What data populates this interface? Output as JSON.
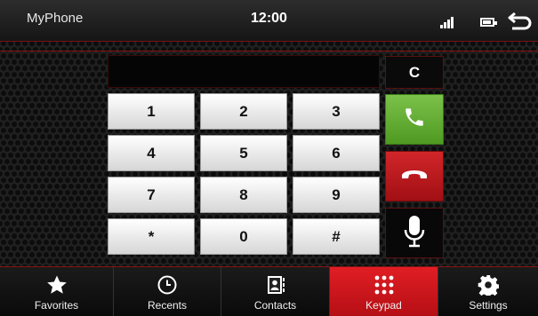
{
  "status": {
    "device_name": "MyPhone",
    "time": "12:00",
    "icons": [
      "signal-icon",
      "battery-icon",
      "back-arrow-icon"
    ]
  },
  "dialer": {
    "display_value": "",
    "clear_label": "C",
    "keys": [
      "1",
      "2",
      "3",
      "4",
      "5",
      "6",
      "7",
      "8",
      "9",
      "*",
      "0",
      "#"
    ],
    "actions": [
      "phone-call-icon",
      "phone-hangup-icon",
      "microphone-icon"
    ]
  },
  "nav": {
    "items": [
      {
        "label": "Favorites",
        "icon": "star-icon"
      },
      {
        "label": "Recents",
        "icon": "clock-icon"
      },
      {
        "label": "Contacts",
        "icon": "contacts-book-icon"
      },
      {
        "label": "Keypad",
        "icon": "keypad-grid-icon",
        "active": true
      },
      {
        "label": "Settings",
        "icon": "gear-icon"
      }
    ]
  },
  "colors": {
    "accent_red": "#c4161c",
    "call_green": "#5ea82e",
    "background": "#202020"
  }
}
